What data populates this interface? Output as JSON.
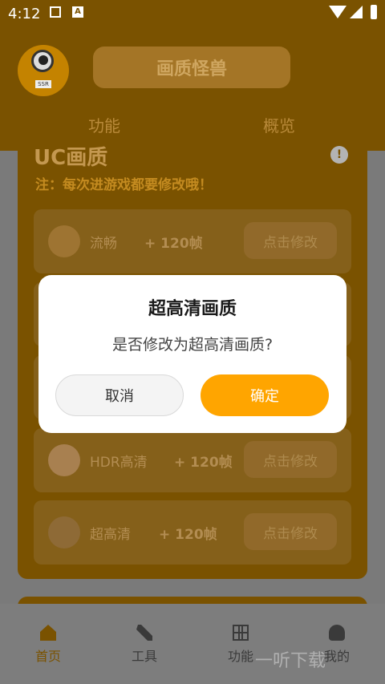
{
  "status_bar": {
    "time": "4:12"
  },
  "header": {
    "app_title": "画质怪兽",
    "tabs": [
      {
        "label": "功能"
      },
      {
        "label": "概览"
      }
    ]
  },
  "section": {
    "title": "UC画质",
    "note": "注：每次进游戏都要修改哦！"
  },
  "options": [
    {
      "name": "流畅",
      "fps": "+ 120帧",
      "button": "点击修改"
    },
    {
      "name": "HDR高清",
      "fps": "+ 120帧",
      "button": "点击修改"
    },
    {
      "name": "超高清",
      "fps": "+ 120帧",
      "button": "点击修改"
    }
  ],
  "dialog": {
    "title": "超高清画质",
    "message": "是否修改为超高清画质?",
    "cancel": "取消",
    "confirm": "确定"
  },
  "bottom_nav": [
    {
      "label": "首页",
      "icon": "home-icon",
      "active": true
    },
    {
      "label": "工具",
      "icon": "tools-icon"
    },
    {
      "label": "功能",
      "icon": "grid-icon"
    },
    {
      "label": "我的",
      "icon": "user-icon"
    }
  ],
  "watermark": "一听下载",
  "colors": {
    "accent": "#ffa500",
    "brand_dim": "#7a5200"
  }
}
